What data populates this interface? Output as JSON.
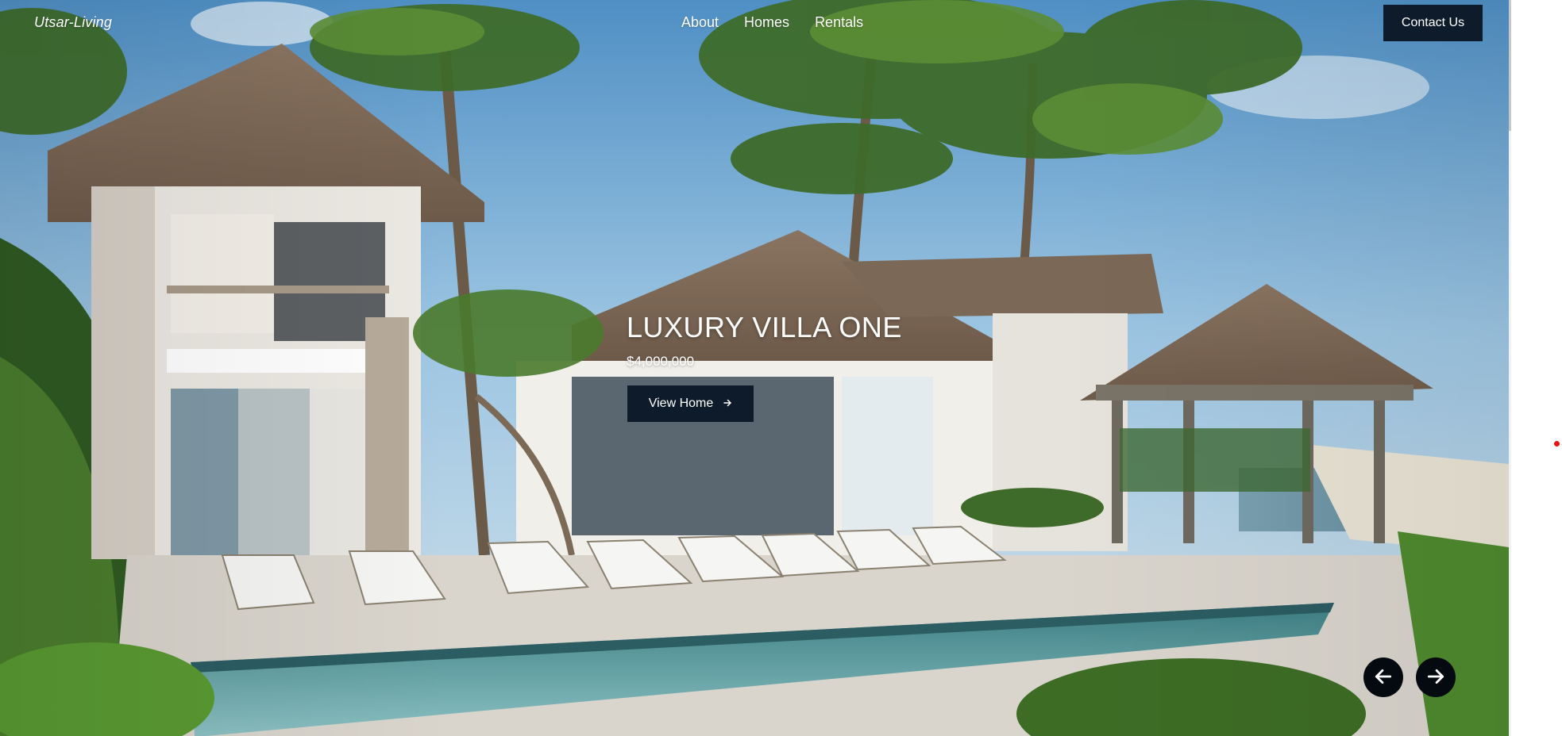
{
  "brand": {
    "name": "Utsar-Living"
  },
  "nav": {
    "items": [
      {
        "label": "About"
      },
      {
        "label": "Homes"
      },
      {
        "label": "Rentals"
      }
    ],
    "contact_label": "Contact Us"
  },
  "hero": {
    "title": "LUXURY VILLA ONE",
    "price": "$4,000,000",
    "cta_label": "View Home",
    "cta_icon": "arrow-right-icon",
    "image_description_icon": "villa-hero-image"
  },
  "carousel": {
    "prev_icon": "arrow-left-icon",
    "next_icon": "arrow-right-icon"
  },
  "colors": {
    "button_bg": "#0d1b2a",
    "carousel_bg": "#050a10",
    "text": "#ffffff"
  }
}
